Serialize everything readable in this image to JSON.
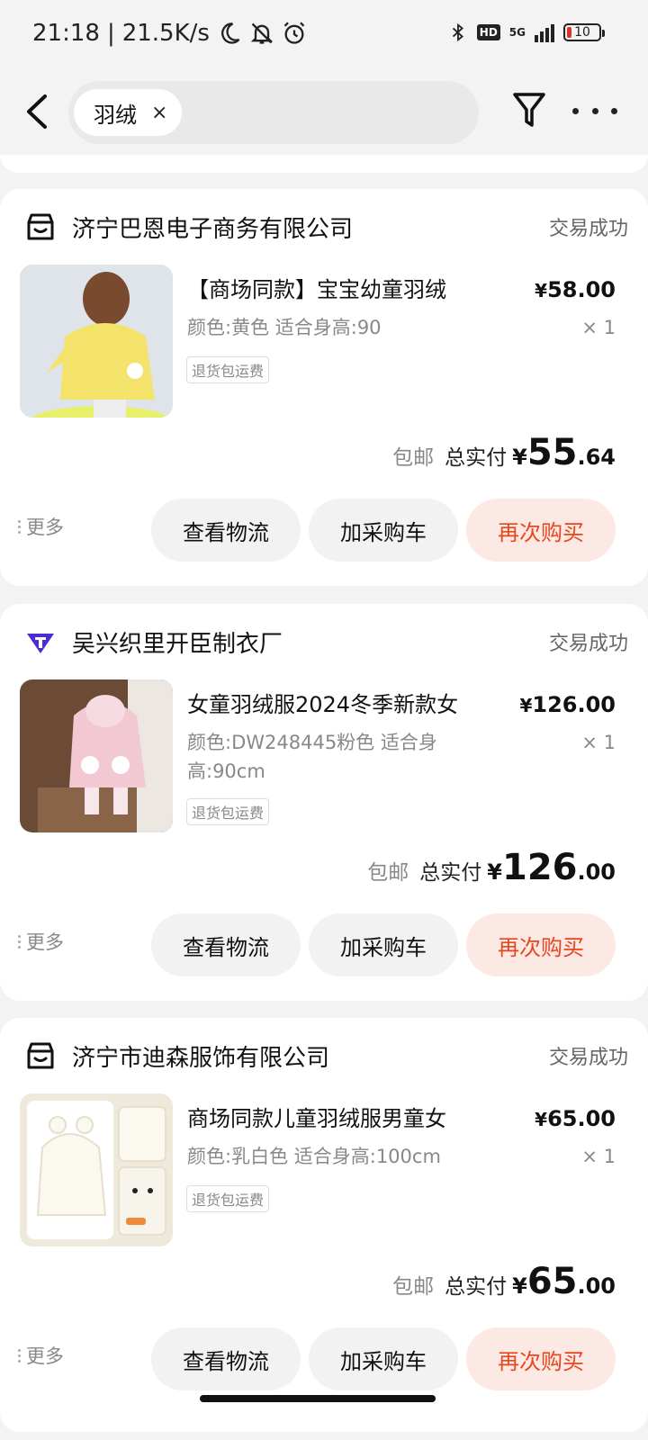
{
  "status_bar": {
    "time": "21:18",
    "network_speed": "21.5K/s",
    "network_type": "5G",
    "hd_label": "HD",
    "battery": "10"
  },
  "header": {
    "search_chip_label": "羽绒",
    "chip_close_symbol": "×"
  },
  "orders": [
    {
      "shop_name": "济宁巴恩电子商务有限公司",
      "shop_icon": "store-icon",
      "status": "交易成功",
      "product_title": "【商场同款】宝宝幼童羽绒",
      "product_spec": "颜色:黄色  适合身高:90",
      "return_tag": "退货包运费",
      "price_symbol": "¥",
      "price": "58.00",
      "quantity": "× 1",
      "free_shipping": "包邮",
      "total_label": "总实付",
      "total_symbol": "¥",
      "total_int": "55",
      "total_dec": ".64",
      "more_label": "更多",
      "btn_logistics": "查看物流",
      "btn_cart": "加采购车",
      "btn_rebuy": "再次购买",
      "thumb_bg": "#dfe3ea",
      "thumb_main": "#f4e36b"
    },
    {
      "shop_name": "吴兴织里开臣制衣厂",
      "shop_icon": "factory-brand-icon",
      "status": "交易成功",
      "product_title": "女童羽绒服2024冬季新款女",
      "product_spec": "颜色:DW248445粉色  适合身高:90cm",
      "return_tag": "退货包运费",
      "price_symbol": "¥",
      "price": "126.00",
      "quantity": "× 1",
      "free_shipping": "包邮",
      "total_label": "总实付",
      "total_symbol": "¥",
      "total_int": "126",
      "total_dec": ".00",
      "more_label": "更多",
      "btn_logistics": "查看物流",
      "btn_cart": "加采购车",
      "btn_rebuy": "再次购买",
      "thumb_bg": "#6b4a36",
      "thumb_main": "#f2c8d2"
    },
    {
      "shop_name": "济宁市迪森服饰有限公司",
      "shop_icon": "store-icon",
      "status": "交易成功",
      "product_title": "商场同款儿童羽绒服男童女",
      "product_spec": "颜色:乳白色  适合身高:100cm",
      "return_tag": "退货包运费",
      "price_symbol": "¥",
      "price": "65.00",
      "quantity": "× 1",
      "free_shipping": "包邮",
      "total_label": "总实付",
      "total_symbol": "¥",
      "total_int": "65",
      "total_dec": ".00",
      "more_label": "更多",
      "btn_logistics": "查看物流",
      "btn_cart": "加采购车",
      "btn_rebuy": "再次购买",
      "thumb_bg": "#efe9dc",
      "thumb_main": "#fbf8f0"
    }
  ],
  "colors": {
    "accent": "#e8461e",
    "accent_bg": "#fde9e3",
    "brand_purple": "#4a2bd6"
  }
}
